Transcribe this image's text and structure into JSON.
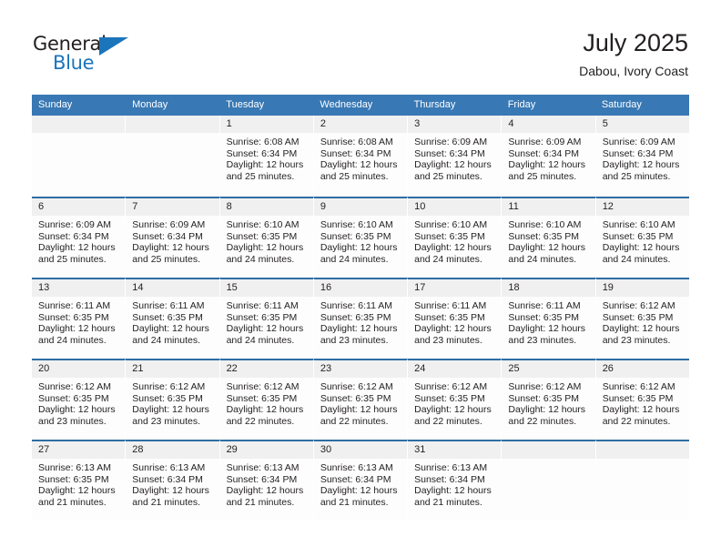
{
  "brand": {
    "name_part1": "General",
    "name_part2": "Blue",
    "logo_icon": "triangle-logo-icon"
  },
  "header": {
    "title": "July 2025",
    "subtitle": "Dabou, Ivory Coast"
  },
  "calendar": {
    "weekdays": [
      "Sunday",
      "Monday",
      "Tuesday",
      "Wednesday",
      "Thursday",
      "Friday",
      "Saturday"
    ],
    "colors": {
      "header_blue": "#3878b4",
      "row_border_blue": "#2e6da4",
      "date_band_gray": "#f0f0f0",
      "brand_blue": "#1b75bb",
      "text": "#231f20"
    },
    "weeks": [
      [
        {
          "date": "",
          "empty": true
        },
        {
          "date": "",
          "empty": true
        },
        {
          "date": "1",
          "sunrise": "Sunrise: 6:08 AM",
          "sunset": "Sunset: 6:34 PM",
          "daylight": "Daylight: 12 hours and 25 minutes."
        },
        {
          "date": "2",
          "sunrise": "Sunrise: 6:08 AM",
          "sunset": "Sunset: 6:34 PM",
          "daylight": "Daylight: 12 hours and 25 minutes."
        },
        {
          "date": "3",
          "sunrise": "Sunrise: 6:09 AM",
          "sunset": "Sunset: 6:34 PM",
          "daylight": "Daylight: 12 hours and 25 minutes."
        },
        {
          "date": "4",
          "sunrise": "Sunrise: 6:09 AM",
          "sunset": "Sunset: 6:34 PM",
          "daylight": "Daylight: 12 hours and 25 minutes."
        },
        {
          "date": "5",
          "sunrise": "Sunrise: 6:09 AM",
          "sunset": "Sunset: 6:34 PM",
          "daylight": "Daylight: 12 hours and 25 minutes."
        }
      ],
      [
        {
          "date": "6",
          "sunrise": "Sunrise: 6:09 AM",
          "sunset": "Sunset: 6:34 PM",
          "daylight": "Daylight: 12 hours and 25 minutes."
        },
        {
          "date": "7",
          "sunrise": "Sunrise: 6:09 AM",
          "sunset": "Sunset: 6:34 PM",
          "daylight": "Daylight: 12 hours and 25 minutes."
        },
        {
          "date": "8",
          "sunrise": "Sunrise: 6:10 AM",
          "sunset": "Sunset: 6:35 PM",
          "daylight": "Daylight: 12 hours and 24 minutes."
        },
        {
          "date": "9",
          "sunrise": "Sunrise: 6:10 AM",
          "sunset": "Sunset: 6:35 PM",
          "daylight": "Daylight: 12 hours and 24 minutes."
        },
        {
          "date": "10",
          "sunrise": "Sunrise: 6:10 AM",
          "sunset": "Sunset: 6:35 PM",
          "daylight": "Daylight: 12 hours and 24 minutes."
        },
        {
          "date": "11",
          "sunrise": "Sunrise: 6:10 AM",
          "sunset": "Sunset: 6:35 PM",
          "daylight": "Daylight: 12 hours and 24 minutes."
        },
        {
          "date": "12",
          "sunrise": "Sunrise: 6:10 AM",
          "sunset": "Sunset: 6:35 PM",
          "daylight": "Daylight: 12 hours and 24 minutes."
        }
      ],
      [
        {
          "date": "13",
          "sunrise": "Sunrise: 6:11 AM",
          "sunset": "Sunset: 6:35 PM",
          "daylight": "Daylight: 12 hours and 24 minutes."
        },
        {
          "date": "14",
          "sunrise": "Sunrise: 6:11 AM",
          "sunset": "Sunset: 6:35 PM",
          "daylight": "Daylight: 12 hours and 24 minutes."
        },
        {
          "date": "15",
          "sunrise": "Sunrise: 6:11 AM",
          "sunset": "Sunset: 6:35 PM",
          "daylight": "Daylight: 12 hours and 24 minutes."
        },
        {
          "date": "16",
          "sunrise": "Sunrise: 6:11 AM",
          "sunset": "Sunset: 6:35 PM",
          "daylight": "Daylight: 12 hours and 23 minutes."
        },
        {
          "date": "17",
          "sunrise": "Sunrise: 6:11 AM",
          "sunset": "Sunset: 6:35 PM",
          "daylight": "Daylight: 12 hours and 23 minutes."
        },
        {
          "date": "18",
          "sunrise": "Sunrise: 6:11 AM",
          "sunset": "Sunset: 6:35 PM",
          "daylight": "Daylight: 12 hours and 23 minutes."
        },
        {
          "date": "19",
          "sunrise": "Sunrise: 6:12 AM",
          "sunset": "Sunset: 6:35 PM",
          "daylight": "Daylight: 12 hours and 23 minutes."
        }
      ],
      [
        {
          "date": "20",
          "sunrise": "Sunrise: 6:12 AM",
          "sunset": "Sunset: 6:35 PM",
          "daylight": "Daylight: 12 hours and 23 minutes."
        },
        {
          "date": "21",
          "sunrise": "Sunrise: 6:12 AM",
          "sunset": "Sunset: 6:35 PM",
          "daylight": "Daylight: 12 hours and 23 minutes."
        },
        {
          "date": "22",
          "sunrise": "Sunrise: 6:12 AM",
          "sunset": "Sunset: 6:35 PM",
          "daylight": "Daylight: 12 hours and 22 minutes."
        },
        {
          "date": "23",
          "sunrise": "Sunrise: 6:12 AM",
          "sunset": "Sunset: 6:35 PM",
          "daylight": "Daylight: 12 hours and 22 minutes."
        },
        {
          "date": "24",
          "sunrise": "Sunrise: 6:12 AM",
          "sunset": "Sunset: 6:35 PM",
          "daylight": "Daylight: 12 hours and 22 minutes."
        },
        {
          "date": "25",
          "sunrise": "Sunrise: 6:12 AM",
          "sunset": "Sunset: 6:35 PM",
          "daylight": "Daylight: 12 hours and 22 minutes."
        },
        {
          "date": "26",
          "sunrise": "Sunrise: 6:12 AM",
          "sunset": "Sunset: 6:35 PM",
          "daylight": "Daylight: 12 hours and 22 minutes."
        }
      ],
      [
        {
          "date": "27",
          "sunrise": "Sunrise: 6:13 AM",
          "sunset": "Sunset: 6:35 PM",
          "daylight": "Daylight: 12 hours and 21 minutes."
        },
        {
          "date": "28",
          "sunrise": "Sunrise: 6:13 AM",
          "sunset": "Sunset: 6:34 PM",
          "daylight": "Daylight: 12 hours and 21 minutes."
        },
        {
          "date": "29",
          "sunrise": "Sunrise: 6:13 AM",
          "sunset": "Sunset: 6:34 PM",
          "daylight": "Daylight: 12 hours and 21 minutes."
        },
        {
          "date": "30",
          "sunrise": "Sunrise: 6:13 AM",
          "sunset": "Sunset: 6:34 PM",
          "daylight": "Daylight: 12 hours and 21 minutes."
        },
        {
          "date": "31",
          "sunrise": "Sunrise: 6:13 AM",
          "sunset": "Sunset: 6:34 PM",
          "daylight": "Daylight: 12 hours and 21 minutes."
        },
        {
          "date": "",
          "empty": true
        },
        {
          "date": "",
          "empty": true
        }
      ]
    ]
  }
}
